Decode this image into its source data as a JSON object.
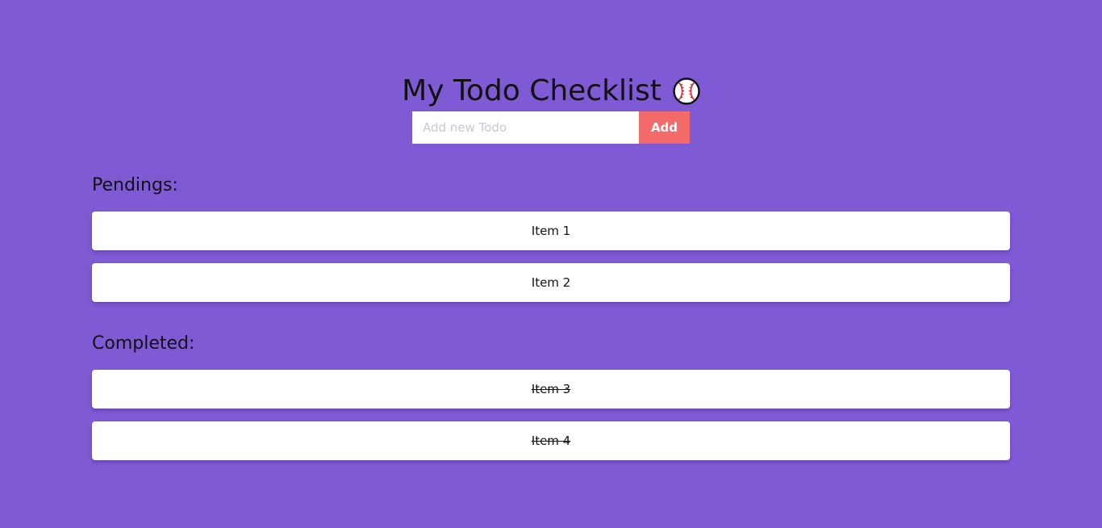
{
  "header": {
    "title": "My Todo Checklist",
    "icon": "baseball-icon"
  },
  "form": {
    "placeholder": "Add new Todo",
    "value": "",
    "add_label": "Add"
  },
  "pending": {
    "heading": "Pendings:",
    "items": [
      "Item 1",
      "Item 2"
    ]
  },
  "completed": {
    "heading": "Completed:",
    "items": [
      "Item 3",
      "Item 4"
    ]
  },
  "colors": {
    "background": "#7f5ad5",
    "add_button": "#f26a6a",
    "card": "#ffffff"
  }
}
